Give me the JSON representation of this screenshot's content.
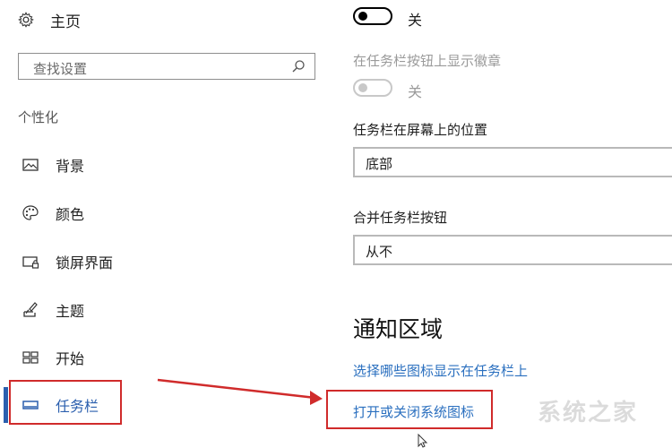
{
  "sidebar": {
    "home_label": "主页",
    "search_placeholder": "查找设置",
    "section_title": "个性化",
    "items": [
      {
        "label": "背景",
        "icon": "picture-icon"
      },
      {
        "label": "颜色",
        "icon": "palette-icon"
      },
      {
        "label": "锁屏界面",
        "icon": "lock-screen-icon"
      },
      {
        "label": "主题",
        "icon": "theme-brush-icon"
      },
      {
        "label": "开始",
        "icon": "start-tiles-icon"
      },
      {
        "label": "任务栏",
        "icon": "taskbar-icon",
        "active": true
      }
    ]
  },
  "main": {
    "toggle1_state": "关",
    "badges_label": "在任务栏按钮上显示徽章",
    "toggle2_state": "关",
    "position_label": "任务栏在屏幕上的位置",
    "position_value": "底部",
    "combine_label": "合并任务栏按钮",
    "combine_value": "从不",
    "notification_heading": "通知区域",
    "link_select_icons": "选择哪些图标显示在任务栏上",
    "link_system_icons": "打开或关闭系统图标"
  },
  "watermark": "系统之家",
  "colors": {
    "accent": "#2b5fae",
    "link": "#2a6fbf",
    "annotation_red": "#d02b2b"
  }
}
